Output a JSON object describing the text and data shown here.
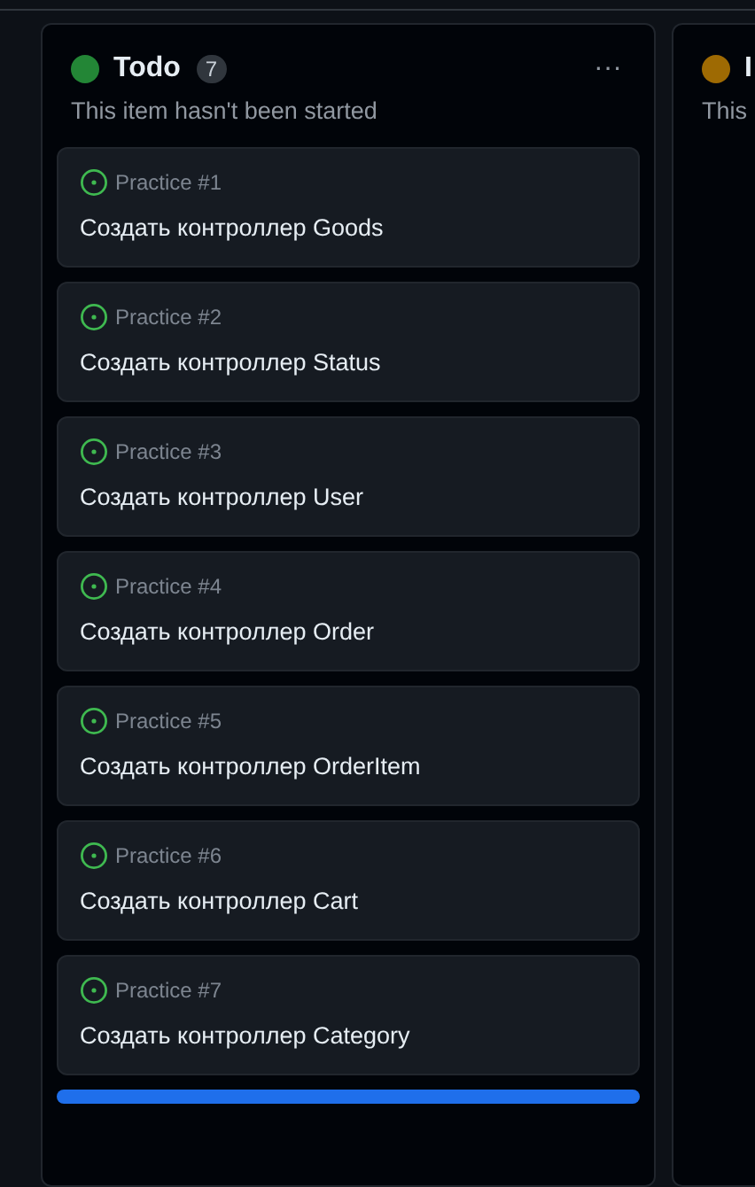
{
  "columns": [
    {
      "title": "Todo",
      "color": "#238636",
      "count": "7",
      "menu": "···",
      "description": "This item hasn't been started",
      "items": [
        {
          "repo": "Practice #1",
          "title": "Создать контроллер Goods"
        },
        {
          "repo": "Practice #2",
          "title": "Создать контроллер Status"
        },
        {
          "repo": "Practice #3",
          "title": "Создать контроллер User"
        },
        {
          "repo": "Practice #4",
          "title": "Создать контроллер Order"
        },
        {
          "repo": "Practice #5",
          "title": "Создать контроллер OrderItem"
        },
        {
          "repo": "Practice #6",
          "title": "Создать контроллер Cart"
        },
        {
          "repo": "Practice #7",
          "title": "Создать контроллер Category"
        }
      ],
      "drop_indicator": true
    },
    {
      "title": "I",
      "color": "#9e6a03",
      "description": "This",
      "drop_indicator": false
    }
  ]
}
